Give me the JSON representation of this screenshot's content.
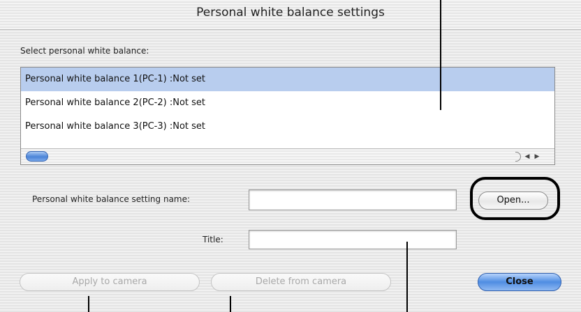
{
  "window": {
    "title": "Personal white balance settings"
  },
  "list": {
    "label": "Select personal white balance:",
    "items": [
      "Personal white balance 1(PC-1) :Not set",
      "Personal white balance 2(PC-2) :Not set",
      "Personal white balance 3(PC-3) :Not set"
    ],
    "selected_index": 0,
    "scroll_arrows": {
      "left": "◀",
      "right": "▶"
    }
  },
  "form": {
    "name_label": "Personal white balance setting name:",
    "name_value": "",
    "title_label": "Title:",
    "title_value": ""
  },
  "buttons": {
    "open": "Open...",
    "apply": "Apply to camera",
    "delete": "Delete from camera",
    "close": "Close"
  },
  "colors": {
    "selection": "#b8cdee",
    "default_button": "#4f8de2",
    "highlight_ring": "#000000"
  }
}
